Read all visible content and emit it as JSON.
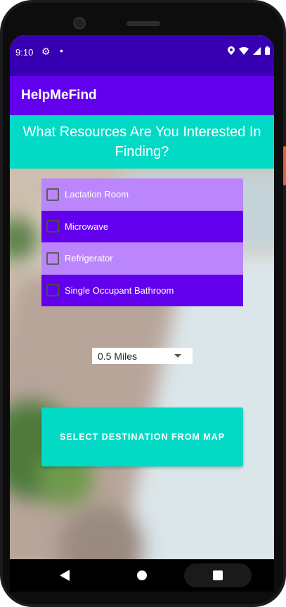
{
  "status_bar": {
    "time": "9:10",
    "icons": [
      "gear-icon",
      "dot-icon",
      "location-icon",
      "wifi-icon",
      "signal-icon",
      "battery-icon"
    ]
  },
  "app_bar": {
    "title": "HelpMeFind",
    "color": "#6200ee"
  },
  "header": {
    "text": "What Resources Are You Interested In Finding?",
    "color": "#03dac5"
  },
  "resources": [
    {
      "label": "Lactation Room",
      "checked": false
    },
    {
      "label": "Microwave",
      "checked": false
    },
    {
      "label": "Refrigerator",
      "checked": false
    },
    {
      "label": "Single Occupant Bathroom",
      "checked": false
    }
  ],
  "distance_spinner": {
    "selected": "0.5 Miles"
  },
  "primary_button": {
    "label": "SELECT DESTINATION FROM MAP",
    "color": "#03dac5"
  },
  "colors": {
    "status_bar": "#3700b3",
    "row_light": "#bb86fc",
    "row_dark": "#6200ee"
  },
  "nav_bar": {
    "icons": [
      "back-icon",
      "home-icon",
      "recents-icon"
    ]
  }
}
